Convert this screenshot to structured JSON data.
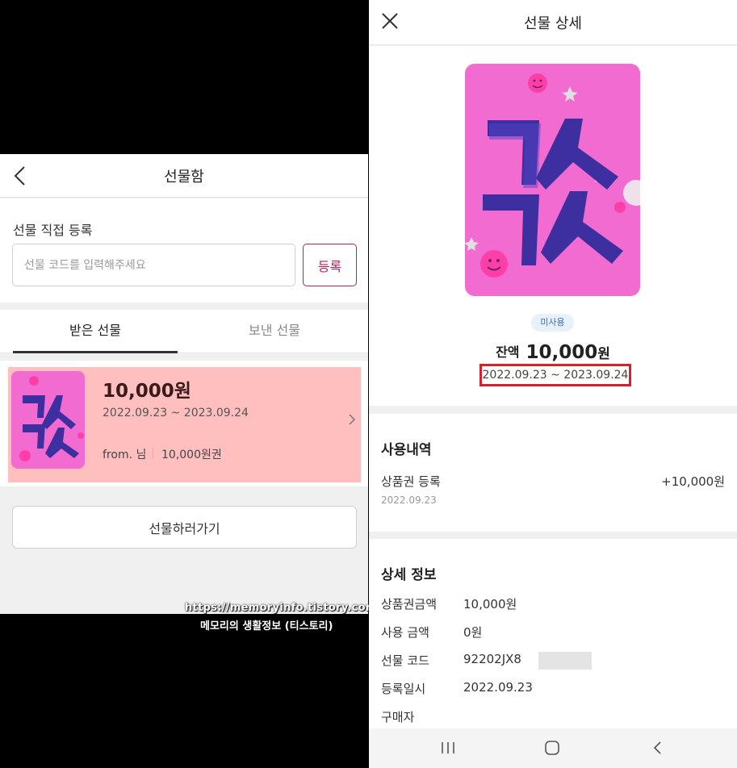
{
  "left_screen": {
    "header": {
      "title": "선물함"
    },
    "register": {
      "label": "선물 직접 등록",
      "placeholder": "선물 코드를 입력해주세요",
      "button": "등록"
    },
    "tabs": [
      {
        "label": "받은 선물",
        "active": true
      },
      {
        "label": "보낸 선물",
        "active": false
      }
    ],
    "gift": {
      "amount": "10,000원",
      "period": "2022.09.23 ~ 2023.09.24",
      "from": "from. 님",
      "voucher": "10,000원권",
      "highlight_color": "#ffbfbf"
    },
    "gift_button": "선물하러가기"
  },
  "watermark": {
    "url": "https://memoryinfo.tistory.com",
    "name": "메모리의 생활정보 (티스토리)"
  },
  "right_screen": {
    "header": {
      "title": "선물 상세"
    },
    "status_badge": "미사용",
    "balance": {
      "label": "잔액",
      "value": "10,000",
      "unit": "원"
    },
    "period": "2022.09.23 ~ 2023.09.24",
    "history": {
      "title": "사용내역",
      "items": [
        {
          "name": "상품권 등록",
          "amount": "+10,000원",
          "date": "2022.09.23"
        }
      ]
    },
    "details": {
      "title": "상세 정보",
      "rows": [
        {
          "key": "상품권금액",
          "value": "10,000원"
        },
        {
          "key": "사용 금액",
          "value": "0원"
        },
        {
          "key": "선물 코드",
          "value": "92202JX8"
        },
        {
          "key": "등록일시",
          "value": "2022.09.23"
        },
        {
          "key": "구매자",
          "value": ""
        }
      ]
    },
    "navbar": [
      "recent-apps-icon",
      "home-icon",
      "back-icon"
    ]
  },
  "colors": {
    "accent": "#b1245e",
    "card_pink": "#f26bd0",
    "letter_purple": "#3d2fa0",
    "highlight_red": "#d8202a"
  }
}
